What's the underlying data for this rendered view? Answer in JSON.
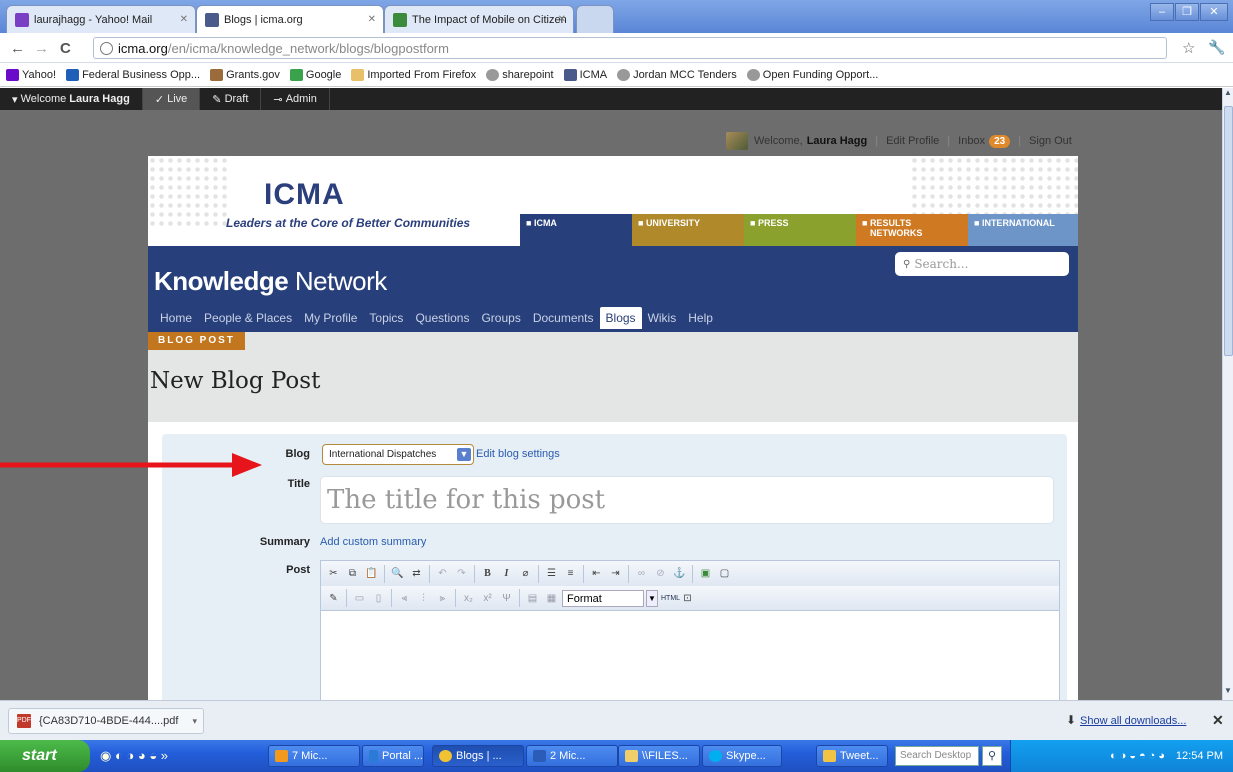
{
  "browser": {
    "tabs": [
      {
        "title": "laurajhagg - Yahoo! Mail"
      },
      {
        "title": "Blogs | icma.org"
      },
      {
        "title": "The Impact of Mobile on Citizen"
      }
    ],
    "url_host": "icma.org",
    "url_path": "/en/icma/knowledge_network/blogs/blogpostform",
    "bookmarks": [
      {
        "label": "Yahoo!",
        "icon": "yahoo-icon",
        "color": "#6b0ac9"
      },
      {
        "label": "Federal Business Opp...",
        "icon": "star-icon",
        "color": "#1f5fb8"
      },
      {
        "label": "Grants.gov",
        "icon": "pen-icon",
        "color": "#9b6b3c"
      },
      {
        "label": "Google",
        "icon": "google-icon",
        "color": "#3aa24b"
      },
      {
        "label": "Imported From Firefox",
        "icon": "folder-icon",
        "color": "#e8c06a"
      },
      {
        "label": "sharepoint",
        "icon": "globe-icon",
        "color": "#777777"
      },
      {
        "label": "ICMA",
        "icon": "icma-icon",
        "color": "#4a5a8a"
      },
      {
        "label": "Jordan MCC Tenders",
        "icon": "globe-icon",
        "color": "#777777"
      },
      {
        "label": "Open Funding Opport...",
        "icon": "smile-icon",
        "color": "#777777"
      }
    ]
  },
  "admin_bar": {
    "welcome_prefix": "Welcome",
    "user": "Laura Hagg",
    "live": "Live",
    "draft": "Draft",
    "admin": "Admin"
  },
  "user_bar": {
    "welcome": "Welcome,",
    "user": "Laura Hagg",
    "edit_profile": "Edit Profile",
    "inbox": "Inbox",
    "inbox_count": "23",
    "sign_out": "Sign Out"
  },
  "site": {
    "logo": "ICMA",
    "tagline": "Leaders at the Core of Better Communities",
    "sections": [
      {
        "label": "ICMA",
        "color": "#273f7a"
      },
      {
        "label": "UNIVERSITY",
        "color": "#b08a2a"
      },
      {
        "label": "PRESS",
        "color": "#8aa12e"
      },
      {
        "label": "RESULTS NETWORKS",
        "color": "#cf7a22"
      },
      {
        "label": "INTERNATIONAL",
        "color": "#6e95c8"
      }
    ],
    "kn_title_bold": "Knowledge",
    "kn_title_rest": "Network",
    "search_placeholder": "Search...",
    "nav": [
      "Home",
      "People & Places",
      "My Profile",
      "Topics",
      "Questions",
      "Groups",
      "Documents",
      "Blogs",
      "Wikis",
      "Help"
    ]
  },
  "form": {
    "breadcrumb": "BLOG POST",
    "page_title": "New Blog Post",
    "blog_label": "Blog",
    "blog_value": "International Dispatches",
    "edit_blog_settings": "Edit blog settings",
    "title_label": "Title",
    "title_placeholder": "The title for this post",
    "summary_label": "Summary",
    "summary_link": "Add custom summary",
    "post_label": "Post",
    "format_value": "Format"
  },
  "downloads": {
    "file": "{CA83D710-4BDE-444....pdf",
    "show_all": "Show all downloads..."
  },
  "taskbar": {
    "start": "start",
    "items": [
      "7 Mic...",
      "Portal ...",
      "Blogs | ...",
      "2 Mic...",
      "\\\\FILES...",
      "Skype...",
      "Tweet..."
    ],
    "search_placeholder": "Search Desktop",
    "clock": "12:54 PM"
  },
  "colors": {
    "accent": "#273f7a",
    "arrow": "#e8141b"
  }
}
